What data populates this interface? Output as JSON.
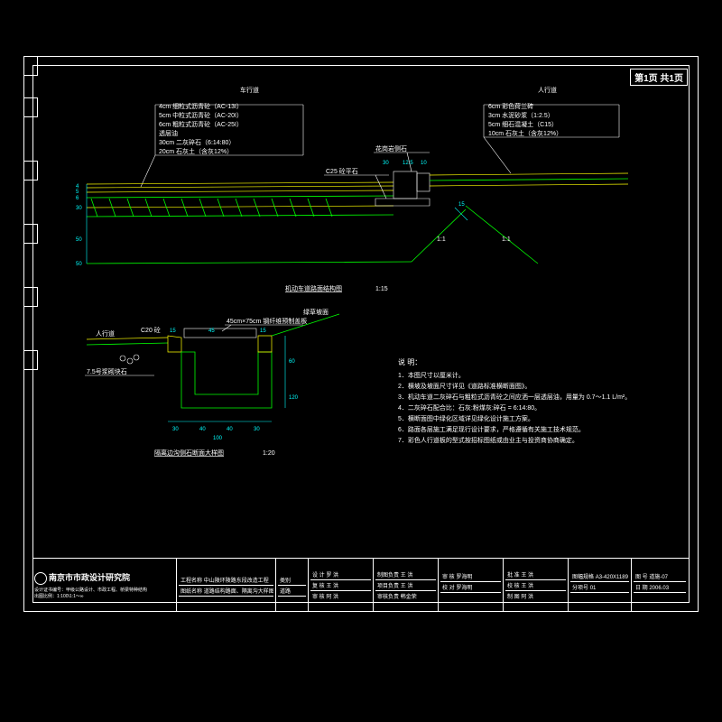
{
  "page_flag": "第1页 共1页",
  "headers": {
    "road": "车行道",
    "sidewalk": "人行道"
  },
  "road_layers": [
    "4cm 细粒式沥青砼（AC-13I）",
    "5cm 中粒式沥青砼（AC-20I）",
    "6cm 粗粒式沥青砼（AC-25I）",
    "透层油",
    "30cm 二灰碎石（6:14:80）",
    "20cm 石灰土（含灰12%）"
  ],
  "sidewalk_layers": [
    "6cm 彩色荷兰砖",
    "3cm 水泥砂浆（1:2.5）",
    "5cm 细石混凝土（C15）",
    "10cm 石灰土（含灰12%）"
  ],
  "labels": {
    "curb": "花岗岩侧石",
    "c25": "C25 砼平石",
    "slope": "1:1",
    "dim15": "15",
    "main_title": "机动车道路面结构图",
    "main_scale": "1:15",
    "detail_title": "隔离边沟侧石断面大样图",
    "detail_scale": "1:20",
    "rxd": "人行道",
    "c20": "C20 砼",
    "base75": "7.5号浆砌块石",
    "grass": "绿草坡面",
    "prefab": "45cm×75cm 钢纤维预制盖板"
  },
  "dims": {
    "v_a": "4",
    "v_b": "5",
    "v_c": "6",
    "v_d": "30",
    "v_e": "50",
    "v_f": "50",
    "h_a": "30",
    "h_b": "12.5",
    "h_c": "10",
    "h_d": "15",
    "h_e": "45",
    "h_f": "15",
    "d_a": "30",
    "d_b": "40",
    "d_c": "40",
    "d_d": "30",
    "d_w": "100",
    "d_h": "120",
    "d_s": "60"
  },
  "notes_title": "说 明：",
  "notes": [
    "1．本图尺寸以厘米计。",
    "2．横坡及坡面尺寸详见《道路标准横断面图》。",
    "3．机动车道二灰碎石与粗粒式沥青砼之间应洒一层透层油，用量为 0.7～1.1 L/m²。",
    "4．二灰碎石配合比：石灰:粉煤灰:碎石 = 6:14:80。",
    "5．横断面图中绿化区域详见绿化设计施工方案。",
    "6．路面各层施工满足现行设计要求，严格遵循有关施工技术规范。",
    "7．彩色人行道板的型式按招标图纸或由业主与投资商协商确定。"
  ],
  "tb": {
    "institute": "南京市市政设计研究院",
    "license": "设计证书编号：甲级公路设计、市政工程、桥梁特种结构",
    "scale": "出图比例：1:100\\1:1～∞",
    "proj_label": "工程名称",
    "proj": "中山陵环陵路东段改造工程",
    "kind_label": "类别",
    "kind": "道路",
    "drawing_label": "图纸名称",
    "drawing": "道路结构路面、隔离沟大样图",
    "roles": [
      [
        "设 计",
        "罗 洪"
      ],
      [
        "复 核",
        "王 洪"
      ],
      [
        "审 核",
        "阿 洪"
      ]
    ],
    "roles2": [
      [
        "制图负责",
        "王 洪"
      ],
      [
        "项目负责",
        "王 洪"
      ],
      [
        "审核负责",
        "韩金荣"
      ]
    ],
    "roles3": [
      [
        "审 核",
        "罗海明"
      ],
      [
        "校 对",
        "罗海明"
      ]
    ],
    "roles4": [
      [
        "批 准",
        "王 洪"
      ],
      [
        "校 核",
        "王 洪"
      ],
      [
        "制 图",
        "阿 洪"
      ]
    ],
    "size_label": "图幅规格",
    "size": "A3-420X1189",
    "num_label": "图 号",
    "num": "道施-07",
    "sheet_label": "分项号",
    "sheet": "01",
    "date_label": "日 期",
    "date": "2006.03"
  }
}
